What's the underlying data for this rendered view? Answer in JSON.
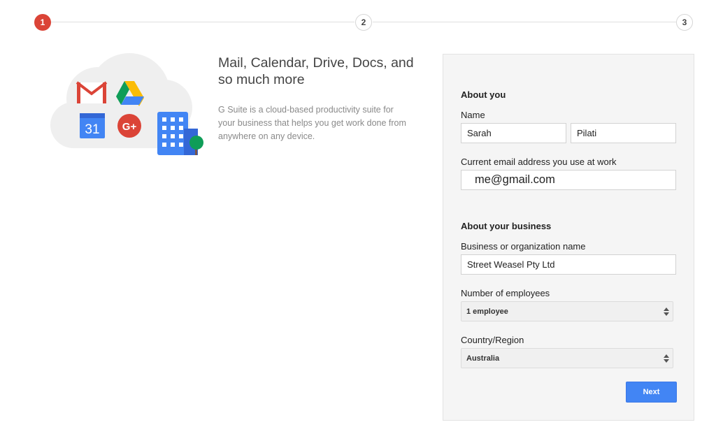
{
  "stepper": {
    "steps": [
      "1",
      "2",
      "3"
    ],
    "active": 1
  },
  "hero": {
    "title": "Mail, Calendar, Drive, Docs, and so much more",
    "description": "G Suite is a cloud-based productivity suite for your business that helps you get work done from anywhere on any device."
  },
  "illustration": {
    "icons": [
      "gmail-icon",
      "drive-icon",
      "calendar-icon",
      "google-plus-icon",
      "building-icon"
    ],
    "calendar_day": "31",
    "gplus_text": "G+"
  },
  "form": {
    "about_you_title": "About you",
    "name_label": "Name",
    "first_name_value": "Sarah",
    "last_name_value": "Pilati",
    "email_label": "Current email address you use at work",
    "email_value": "me@gmail.com",
    "about_business_title": "About your business",
    "business_name_label": "Business or organization name",
    "business_name_value": "Street Weasel Pty Ltd",
    "employees_label": "Number of employees",
    "employees_value": "1 employee",
    "country_label": "Country/Region",
    "country_value": "Australia",
    "next_label": "Next"
  },
  "colors": {
    "step_active": "#db4437",
    "primary_button": "#4285f4",
    "panel_bg": "#f5f5f5"
  }
}
